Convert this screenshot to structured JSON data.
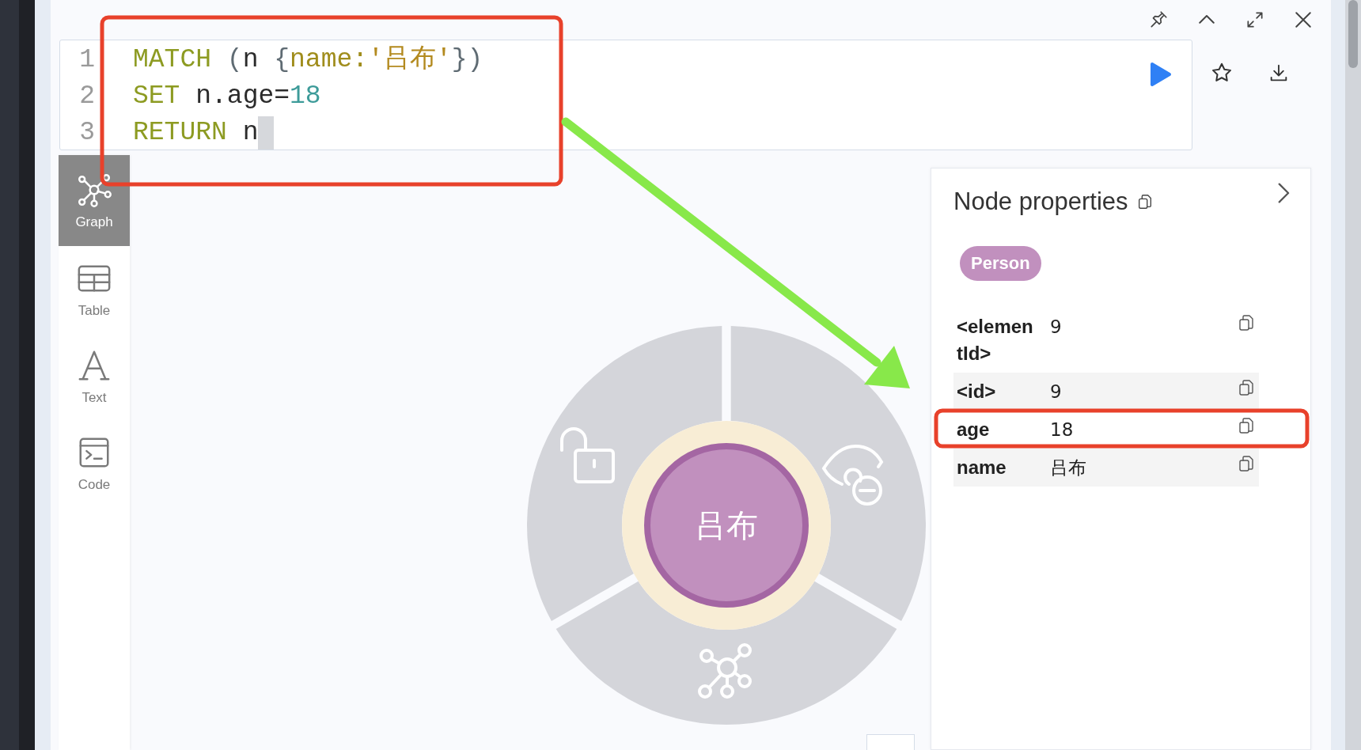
{
  "editor": {
    "lines": [
      {
        "number": "1",
        "cursor": false,
        "tokens": [
          {
            "kind": "keyword",
            "text": "MATCH"
          },
          {
            "kind": "punct",
            "text": " ("
          },
          {
            "kind": "plain",
            "text": "n "
          },
          {
            "kind": "punct",
            "text": "{"
          },
          {
            "kind": "property",
            "text": "name:"
          },
          {
            "kind": "string",
            "text": "'吕布'"
          },
          {
            "kind": "punct",
            "text": "})"
          }
        ]
      },
      {
        "number": "2",
        "cursor": false,
        "tokens": [
          {
            "kind": "keyword",
            "text": "SET"
          },
          {
            "kind": "plain",
            "text": " n.age="
          },
          {
            "kind": "number",
            "text": "18"
          }
        ]
      },
      {
        "number": "3",
        "cursor": true,
        "tokens": [
          {
            "kind": "keyword",
            "text": "RETURN"
          },
          {
            "kind": "plain",
            "text": " n"
          }
        ]
      }
    ]
  },
  "sidebar": {
    "items": [
      {
        "kind": "graph",
        "label": "Graph",
        "selected": true
      },
      {
        "kind": "table",
        "label": "Table",
        "selected": false
      },
      {
        "kind": "text",
        "label": "Text",
        "selected": false
      },
      {
        "kind": "code",
        "label": "Code",
        "selected": false
      }
    ]
  },
  "graph": {
    "node": {
      "caption": "吕布",
      "color": "#c190be",
      "selected": true
    }
  },
  "properties": {
    "title": "Node properties",
    "labels": [
      {
        "text": "Person",
        "color": "#c190be"
      }
    ],
    "rows": [
      {
        "key": "<elementId>",
        "value": "9"
      },
      {
        "key": "<id>",
        "value": "9"
      },
      {
        "key": "age",
        "value": "18"
      },
      {
        "key": "name",
        "value": "吕布"
      }
    ]
  },
  "annotations": [
    {
      "kind": "box"
    },
    {
      "kind": "box"
    },
    {
      "kind": "arrow"
    }
  ]
}
